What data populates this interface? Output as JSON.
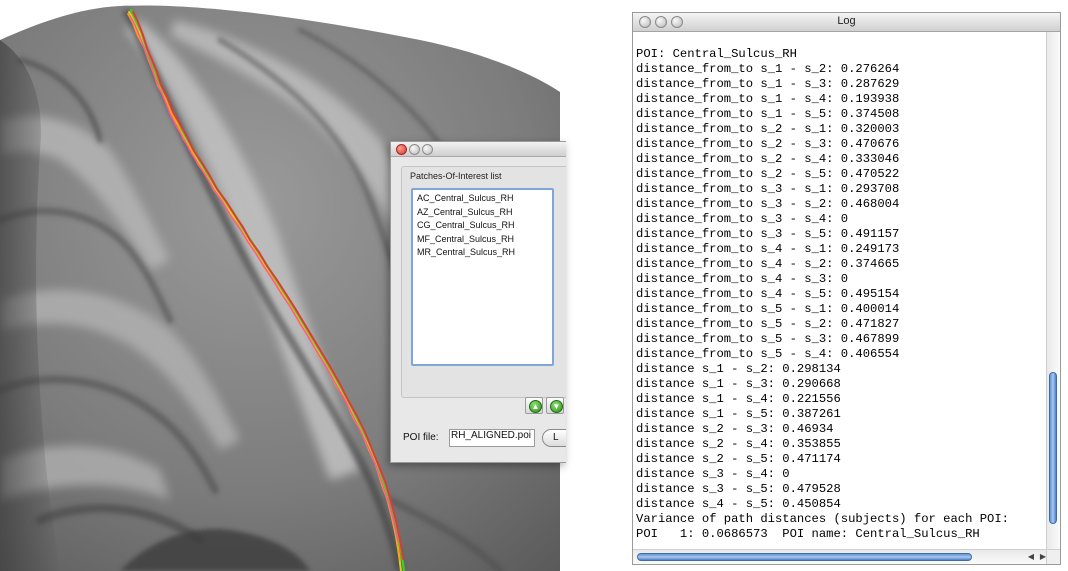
{
  "poi_dialog": {
    "group_label": "Patches-Of-Interest list",
    "items": [
      "AC_Central_Sulcus_RH",
      "AZ_Central_Sulcus_RH",
      "CG_Central_Sulcus_RH",
      "MF_Central_Sulcus_RH",
      "MR_Central_Sulcus_RH"
    ],
    "up_icon": "up-arrow-icon",
    "down_icon": "down-arrow-icon",
    "file_label": "POI file:",
    "file_value": "RH_ALIGNED.poi",
    "load_button_label": "L"
  },
  "log_window": {
    "title": "Log",
    "lines": [
      "POI: Central_Sulcus_RH",
      "distance_from_to s_1 - s_2: 0.276264",
      "distance_from_to s_1 - s_3: 0.287629",
      "distance_from_to s_1 - s_4: 0.193938",
      "distance_from_to s_1 - s_5: 0.374508",
      "distance_from_to s_2 - s_1: 0.320003",
      "distance_from_to s_2 - s_3: 0.470676",
      "distance_from_to s_2 - s_4: 0.333046",
      "distance_from_to s_2 - s_5: 0.470522",
      "distance_from_to s_3 - s_1: 0.293708",
      "distance_from_to s_3 - s_2: 0.468004",
      "distance_from_to s_3 - s_4: 0",
      "distance_from_to s_3 - s_5: 0.491157",
      "distance_from_to s_4 - s_1: 0.249173",
      "distance_from_to s_4 - s_2: 0.374665",
      "distance_from_to s_4 - s_3: 0",
      "distance_from_to s_4 - s_5: 0.495154",
      "distance_from_to s_5 - s_1: 0.400014",
      "distance_from_to s_5 - s_2: 0.471827",
      "distance_from_to s_5 - s_3: 0.467899",
      "distance_from_to s_5 - s_4: 0.406554",
      "distance s_1 - s_2: 0.298134",
      "distance s_1 - s_3: 0.290668",
      "distance s_1 - s_4: 0.221556",
      "distance s_1 - s_5: 0.387261",
      "distance s_2 - s_3: 0.46934",
      "distance s_2 - s_4: 0.353855",
      "distance s_2 - s_5: 0.471174",
      "distance s_3 - s_4: 0",
      "distance s_3 - s_5: 0.479528",
      "distance s_4 - s_5: 0.450854",
      "Variance of path distances (subjects) for each POI:",
      "POI   1: 0.0686573  POI name: Central_Sulcus_RH"
    ]
  },
  "colors": {
    "surface_light": "#a6a6a6",
    "surface_dark": "#3f3f3f",
    "path_red": "#e8323c",
    "path_green": "#3fcf1e",
    "path_orange": "#ff9a1a",
    "path_pink": "#ff4fa8",
    "path_yellow": "#e0c92a",
    "selection_blue": "#7fa6d8"
  }
}
